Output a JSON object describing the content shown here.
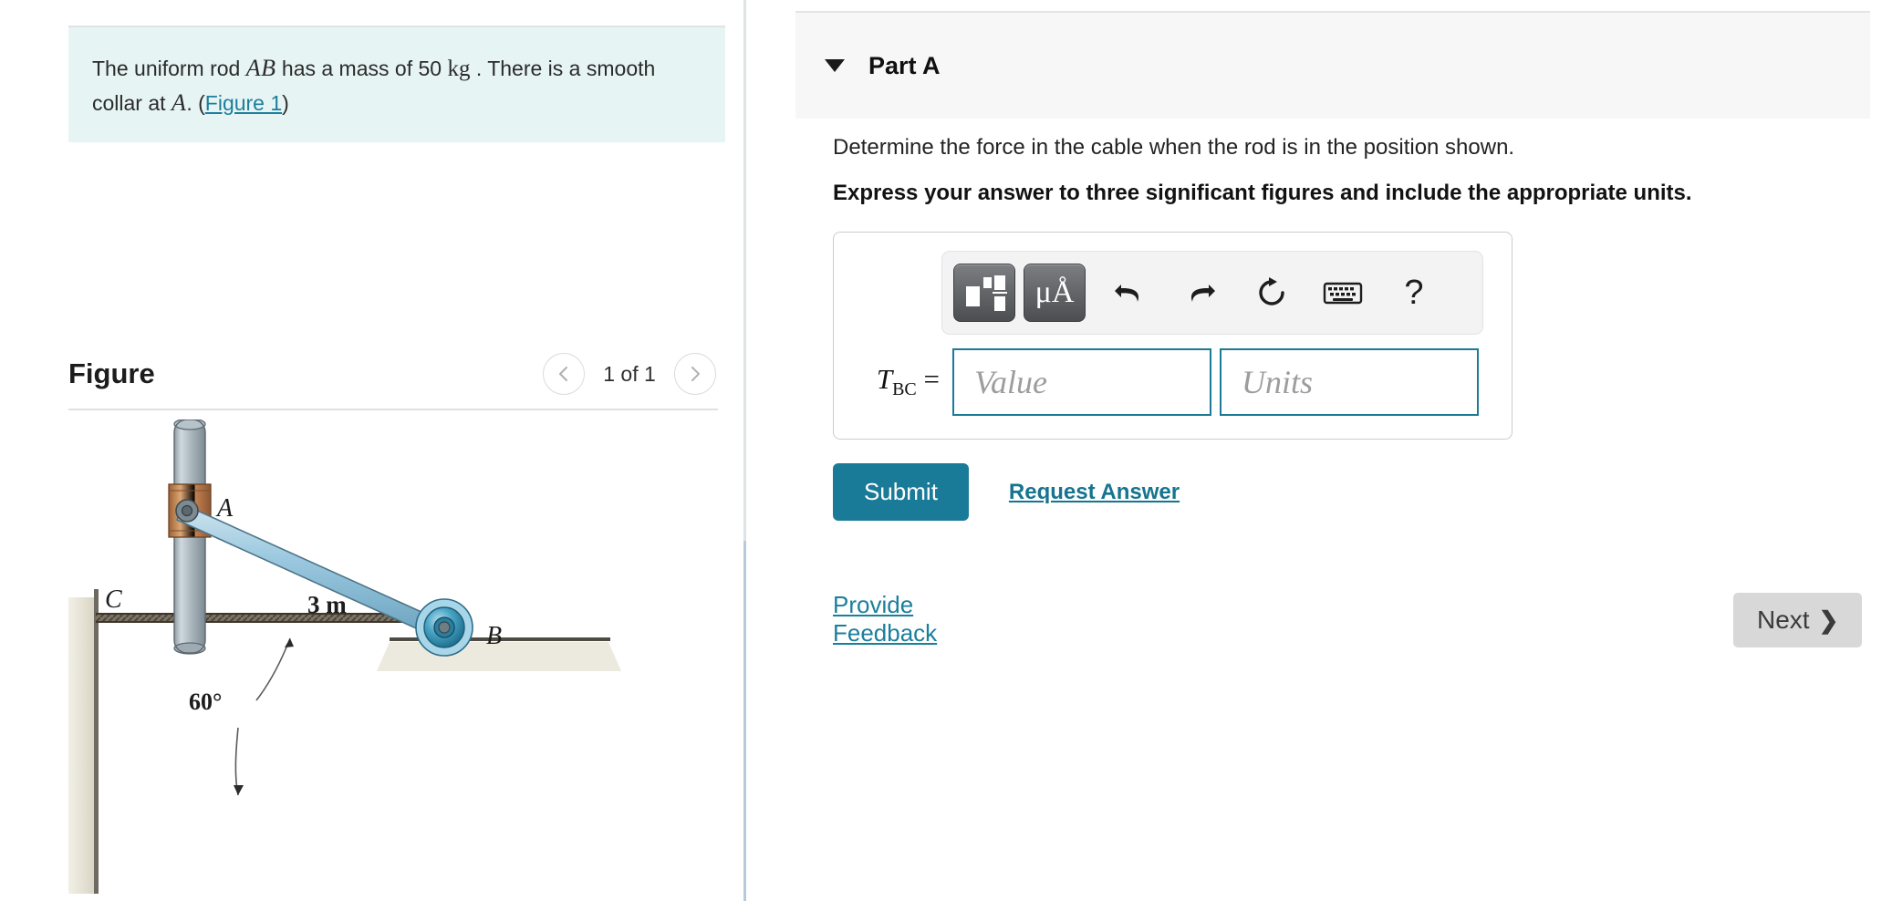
{
  "problem": {
    "text_part1": "The uniform rod ",
    "var_ab": "AB",
    "text_part2": " has a mass of 50 ",
    "unit_kg": "kg",
    "text_part3": " . There is a smooth collar at ",
    "var_a": "A",
    "text_part4": ". (",
    "figure_link": "Figure 1",
    "text_part5": ")"
  },
  "figure": {
    "title": "Figure",
    "pager": {
      "prev_icon": "chevron-left-icon",
      "count_label": "1 of 1",
      "next_icon": "chevron-right-icon"
    },
    "diagram": {
      "label_a": "A",
      "label_b": "B",
      "label_c": "C",
      "label_length": "3 m",
      "label_angle": "60°",
      "colors": {
        "rod": "#9dc8de",
        "rod_edge": "#5b7d8f",
        "guide": "#b6c2ca",
        "collar": "#c98b5e",
        "roller": "#2a8fb0",
        "wall": "#e6e3da",
        "cable": "#6b6254"
      }
    }
  },
  "part": {
    "caret_icon": "caret-down-icon",
    "title": "Part A",
    "prompt": "Determine the force in the cable when the rod is in the position shown.",
    "instruction": "Express your answer to three significant figures and include the appropriate units."
  },
  "answer": {
    "toolbar": [
      {
        "name": "math-template-button",
        "icon": "math-template-icon",
        "label": ""
      },
      {
        "name": "units-button",
        "icon": "mu-angstrom-icon",
        "label": "μÅ"
      },
      {
        "name": "undo-button",
        "icon": "undo-icon",
        "label": "↶"
      },
      {
        "name": "redo-button",
        "icon": "redo-icon",
        "label": "↷"
      },
      {
        "name": "reset-button",
        "icon": "reset-icon",
        "label": "↻"
      },
      {
        "name": "keyboard-button",
        "icon": "keyboard-icon",
        "label": "⌨"
      },
      {
        "name": "help-button",
        "icon": "question-mark-icon",
        "label": "?"
      }
    ],
    "variable_main": "T",
    "variable_sub": "BC",
    "equals": "=",
    "value_placeholder": "Value",
    "value_current": "",
    "units_placeholder": "Units",
    "units_current": "",
    "submit_label": "Submit",
    "request_answer_label": "Request Answer"
  },
  "footer": {
    "feedback_label": "Provide Feedback",
    "next_label": "Next",
    "next_icon": "chevron-right-icon"
  },
  "colors": {
    "accent_teal": "#1a7b99",
    "link_teal": "#1a7f9c",
    "statement_bg": "#e7f4f4",
    "header_bg": "#f7f7f7",
    "next_bg": "#d8d8d8"
  }
}
